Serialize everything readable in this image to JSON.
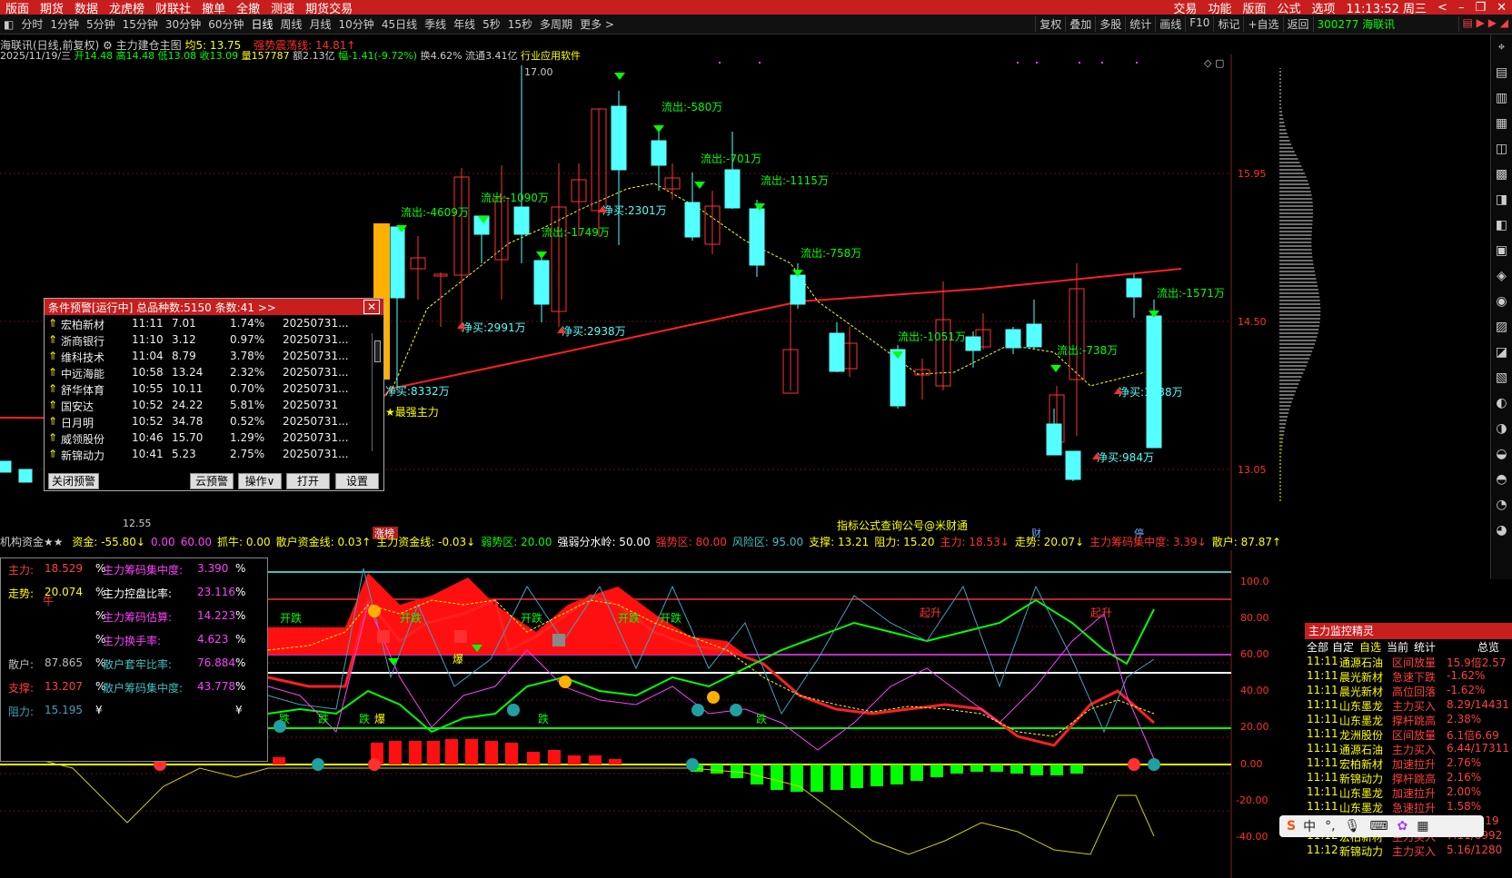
{
  "menubar": {
    "items": [
      "版面",
      "期货",
      "数据",
      "龙虎榜",
      "财联社",
      "撤单",
      "全撤",
      "测速",
      "期货交易"
    ],
    "right": [
      "交易",
      "功能",
      "版面",
      "公式",
      "选项"
    ],
    "time": "11:13:52 周三"
  },
  "toolbar": {
    "periods": [
      "分时",
      "1分钟",
      "5分钟",
      "15分钟",
      "30分钟",
      "60分钟",
      "日线",
      "周线",
      "月线",
      "10分钟",
      "45日线",
      "季线",
      "年线",
      "5秒",
      "15秒",
      "多周期",
      "更多 >"
    ],
    "active": "日线",
    "right": [
      "复权",
      "叠加",
      "多股",
      "统计",
      "画线",
      "F10",
      "标记",
      "+自选",
      "返回"
    ]
  },
  "stock_tab": "300277 海联讯",
  "header": {
    "line1": {
      "name": "海联讯(日线,前复权)",
      "indicator": "主力建仓主图",
      "ma5": "均5: 13.75",
      "boundary": "强势震荡线: 14.81"
    },
    "line2": {
      "date": "2025/11/19/三",
      "open": "开14.48",
      "high": "高14.48",
      "low": "低13.08",
      "close": "收13.09",
      "vol": "量157787",
      "amount": "额2.13亿",
      "change": "幅-1.41(-9.72%)",
      "turnover": "换4.62%",
      "float": "流通3.41亿",
      "industry": "行业应用软件"
    }
  },
  "price_axis": [
    "15.95",
    "14.50",
    "13.05"
  ],
  "candle_labels": {
    "high": "17.00",
    "low": "12.55",
    "outflows": [
      "流出:-4609万",
      "流出:-1090万",
      "流出:-1749万",
      "流出:-580万",
      "流出:-701万",
      "流出:-1115万",
      "流出:-758万",
      "流出:-1051万",
      "流出:-738万",
      "流出:-1571万"
    ],
    "inflows": [
      "净买:2991万",
      "净买:2938万",
      "净买:2301万",
      "净买:8332万",
      "净买:1138万",
      "净买:984万"
    ],
    "strongest": "★最强主力",
    "watermark": "指标公式查询公号@米财通",
    "markers": [
      "涨榜",
      "财",
      "停"
    ]
  },
  "alert": {
    "title": "条件预警[运行中] 总品种数:5150 条数:41 >>",
    "rows": [
      {
        "name": "宏柏新材",
        "time": "11:11",
        "price": "7.01",
        "pct": "1.74%",
        "date": "20250731..."
      },
      {
        "name": "浙商银行",
        "time": "11:10",
        "price": "3.12",
        "pct": "0.97%",
        "date": "20250731..."
      },
      {
        "name": "维科技术",
        "time": "11:04",
        "price": "8.79",
        "pct": "3.78%",
        "date": "20250731..."
      },
      {
        "name": "中远海能",
        "time": "10:58",
        "price": "13.24",
        "pct": "2.32%",
        "date": "20250731..."
      },
      {
        "name": "舒华体育",
        "time": "10:55",
        "price": "10.11",
        "pct": "0.70%",
        "date": "20250731..."
      },
      {
        "name": "国安达",
        "time": "10:52",
        "price": "24.22",
        "pct": "5.81%",
        "date": "20250731"
      },
      {
        "name": "日月明",
        "time": "10:52",
        "price": "34.78",
        "pct": "0.52%",
        "date": "20250731..."
      },
      {
        "name": "威领股份",
        "time": "10:46",
        "price": "15.70",
        "pct": "1.29%",
        "date": "20250731..."
      },
      {
        "name": "新锦动力",
        "time": "10:41",
        "price": "5.23",
        "pct": "2.75%",
        "date": "20250731..."
      }
    ],
    "buttons": [
      "关闭预警",
      "云预警",
      "操作∨",
      "打开",
      "设置"
    ]
  },
  "sub": {
    "title": "机构资金★★",
    "items": [
      {
        "t": "资金: -55.80↓",
        "c": "#ffff00"
      },
      {
        "t": "0.00",
        "c": "#ff40ff"
      },
      {
        "t": "60.00",
        "c": "#ff40ff"
      },
      {
        "t": "抓牛: 0.00",
        "c": "#ffff00"
      },
      {
        "t": "散户资金线: 0.03↑",
        "c": "#ffff00"
      },
      {
        "t": "主力资金线: -0.03↓",
        "c": "#ffff00"
      },
      {
        "t": "弱势区: 20.00",
        "c": "#00ff00"
      },
      {
        "t": "强弱分水岭: 50.00",
        "c": "#ffffff"
      },
      {
        "t": "强势区: 80.00",
        "c": "#ff3030"
      },
      {
        "t": "风险区: 95.00",
        "c": "#40c0c0"
      },
      {
        "t": "支撑: 13.21",
        "c": "#ffff00"
      },
      {
        "t": "阻力: 15.20",
        "c": "#ffff00"
      },
      {
        "t": "主力: 18.53↓",
        "c": "#ff3030"
      },
      {
        "t": "走势: 20.07↓",
        "c": "#ffff00"
      },
      {
        "t": "主力筹码集中度: 3.39↓",
        "c": "#ff3030"
      },
      {
        "t": "散户: 87.87↑",
        "c": "#ffff00"
      },
      {
        "t": "散户",
        "c": "#40c0c0"
      }
    ],
    "axis": [
      "100.0",
      "80.00",
      "60.00",
      "40.00",
      "20.00",
      "0.00",
      "-20.00",
      "-40.00"
    ],
    "texts": {
      "kd": [
        "开跌",
        "开跌",
        "开跌",
        "开跌",
        "开跌"
      ],
      "qs": [
        "起升",
        "起升"
      ],
      "die": "跌",
      "bao": "爆",
      "niu": "牛"
    }
  },
  "lpanel": [
    {
      "l": "主力:",
      "v": "18.529",
      "l2": "主力筹码集中度:",
      "v2": "3.390",
      "u": "%"
    },
    {
      "l": "走势:",
      "v": "20.074",
      "l2": "主力控盘比率:",
      "v2": "23.116",
      "u": "%"
    },
    {
      "l": "",
      "v": "",
      "l2": "主力筹码估算:",
      "v2": "14.223",
      "u": "%"
    },
    {
      "l": "",
      "v": "",
      "l2": "主力换手率:",
      "v2": "4.623",
      "u": "%"
    },
    {
      "l": "散户:",
      "v": "87.865",
      "l2": "散户套牢比率:",
      "v2": "76.884",
      "u": "%"
    },
    {
      "l": "支撑:",
      "v": "13.207",
      "l2": "散户筹码集中度:",
      "v2": "43.778",
      "u": "%"
    },
    {
      "l": "阻力:",
      "v": "15.195",
      "l2": "",
      "v2": "",
      "u": "¥"
    }
  ],
  "monitor": {
    "title": "主力监控精灵",
    "tabs": [
      "全部",
      "自定",
      "自选",
      "当前",
      "统计"
    ],
    "tab_right": "总览",
    "rows": [
      {
        "t": "11:11",
        "n": "通源石油",
        "e": "区间放量",
        "v": "15.9倍2.57"
      },
      {
        "t": "11:11",
        "n": "晨光新材",
        "e": "急速下跌",
        "v": "-1.62%"
      },
      {
        "t": "11:11",
        "n": "晨光新材",
        "e": "高位回落",
        "v": "-1.62%"
      },
      {
        "t": "11:11",
        "n": "山东墨龙",
        "e": "主力买入",
        "v": "8.29/14431"
      },
      {
        "t": "11:11",
        "n": "山东墨龙",
        "e": "撑杆跳高",
        "v": "2.38%"
      },
      {
        "t": "11:11",
        "n": "龙洲股份",
        "e": "区间放量",
        "v": "6.1倍6.69"
      },
      {
        "t": "11:11",
        "n": "通源石油",
        "e": "主力买入",
        "v": "6.44/17311"
      },
      {
        "t": "11:11",
        "n": "宏柏新材",
        "e": "加速拉升",
        "v": "2.76%"
      },
      {
        "t": "11:11",
        "n": "新锦动力",
        "e": "撑杆跳高",
        "v": "2.16%"
      },
      {
        "t": "11:11",
        "n": "山东墨龙",
        "e": "加速拉升",
        "v": "2.00%"
      },
      {
        "t": "11:11",
        "n": "山东墨龙",
        "e": "急速拉升",
        "v": "1.58%"
      },
      {
        "t": "11:12",
        "n": "山东墨龙",
        "e": "主力买入",
        "v": "8.24/2.19"
      },
      {
        "t": "11:12",
        "n": "宏柏新材",
        "e": "主力买入",
        "v": "7.11/6992"
      },
      {
        "t": "11:12",
        "n": "新锦动力",
        "e": "主力买入",
        "v": "5.16/1280"
      }
    ]
  },
  "ime": {
    "items": [
      "中",
      "°,"
    ]
  },
  "side_labels": [
    "成本",
    "平均"
  ],
  "colors": {
    "up": "#ff3232",
    "down": "#54ffff",
    "accent": "#c81e1e"
  }
}
